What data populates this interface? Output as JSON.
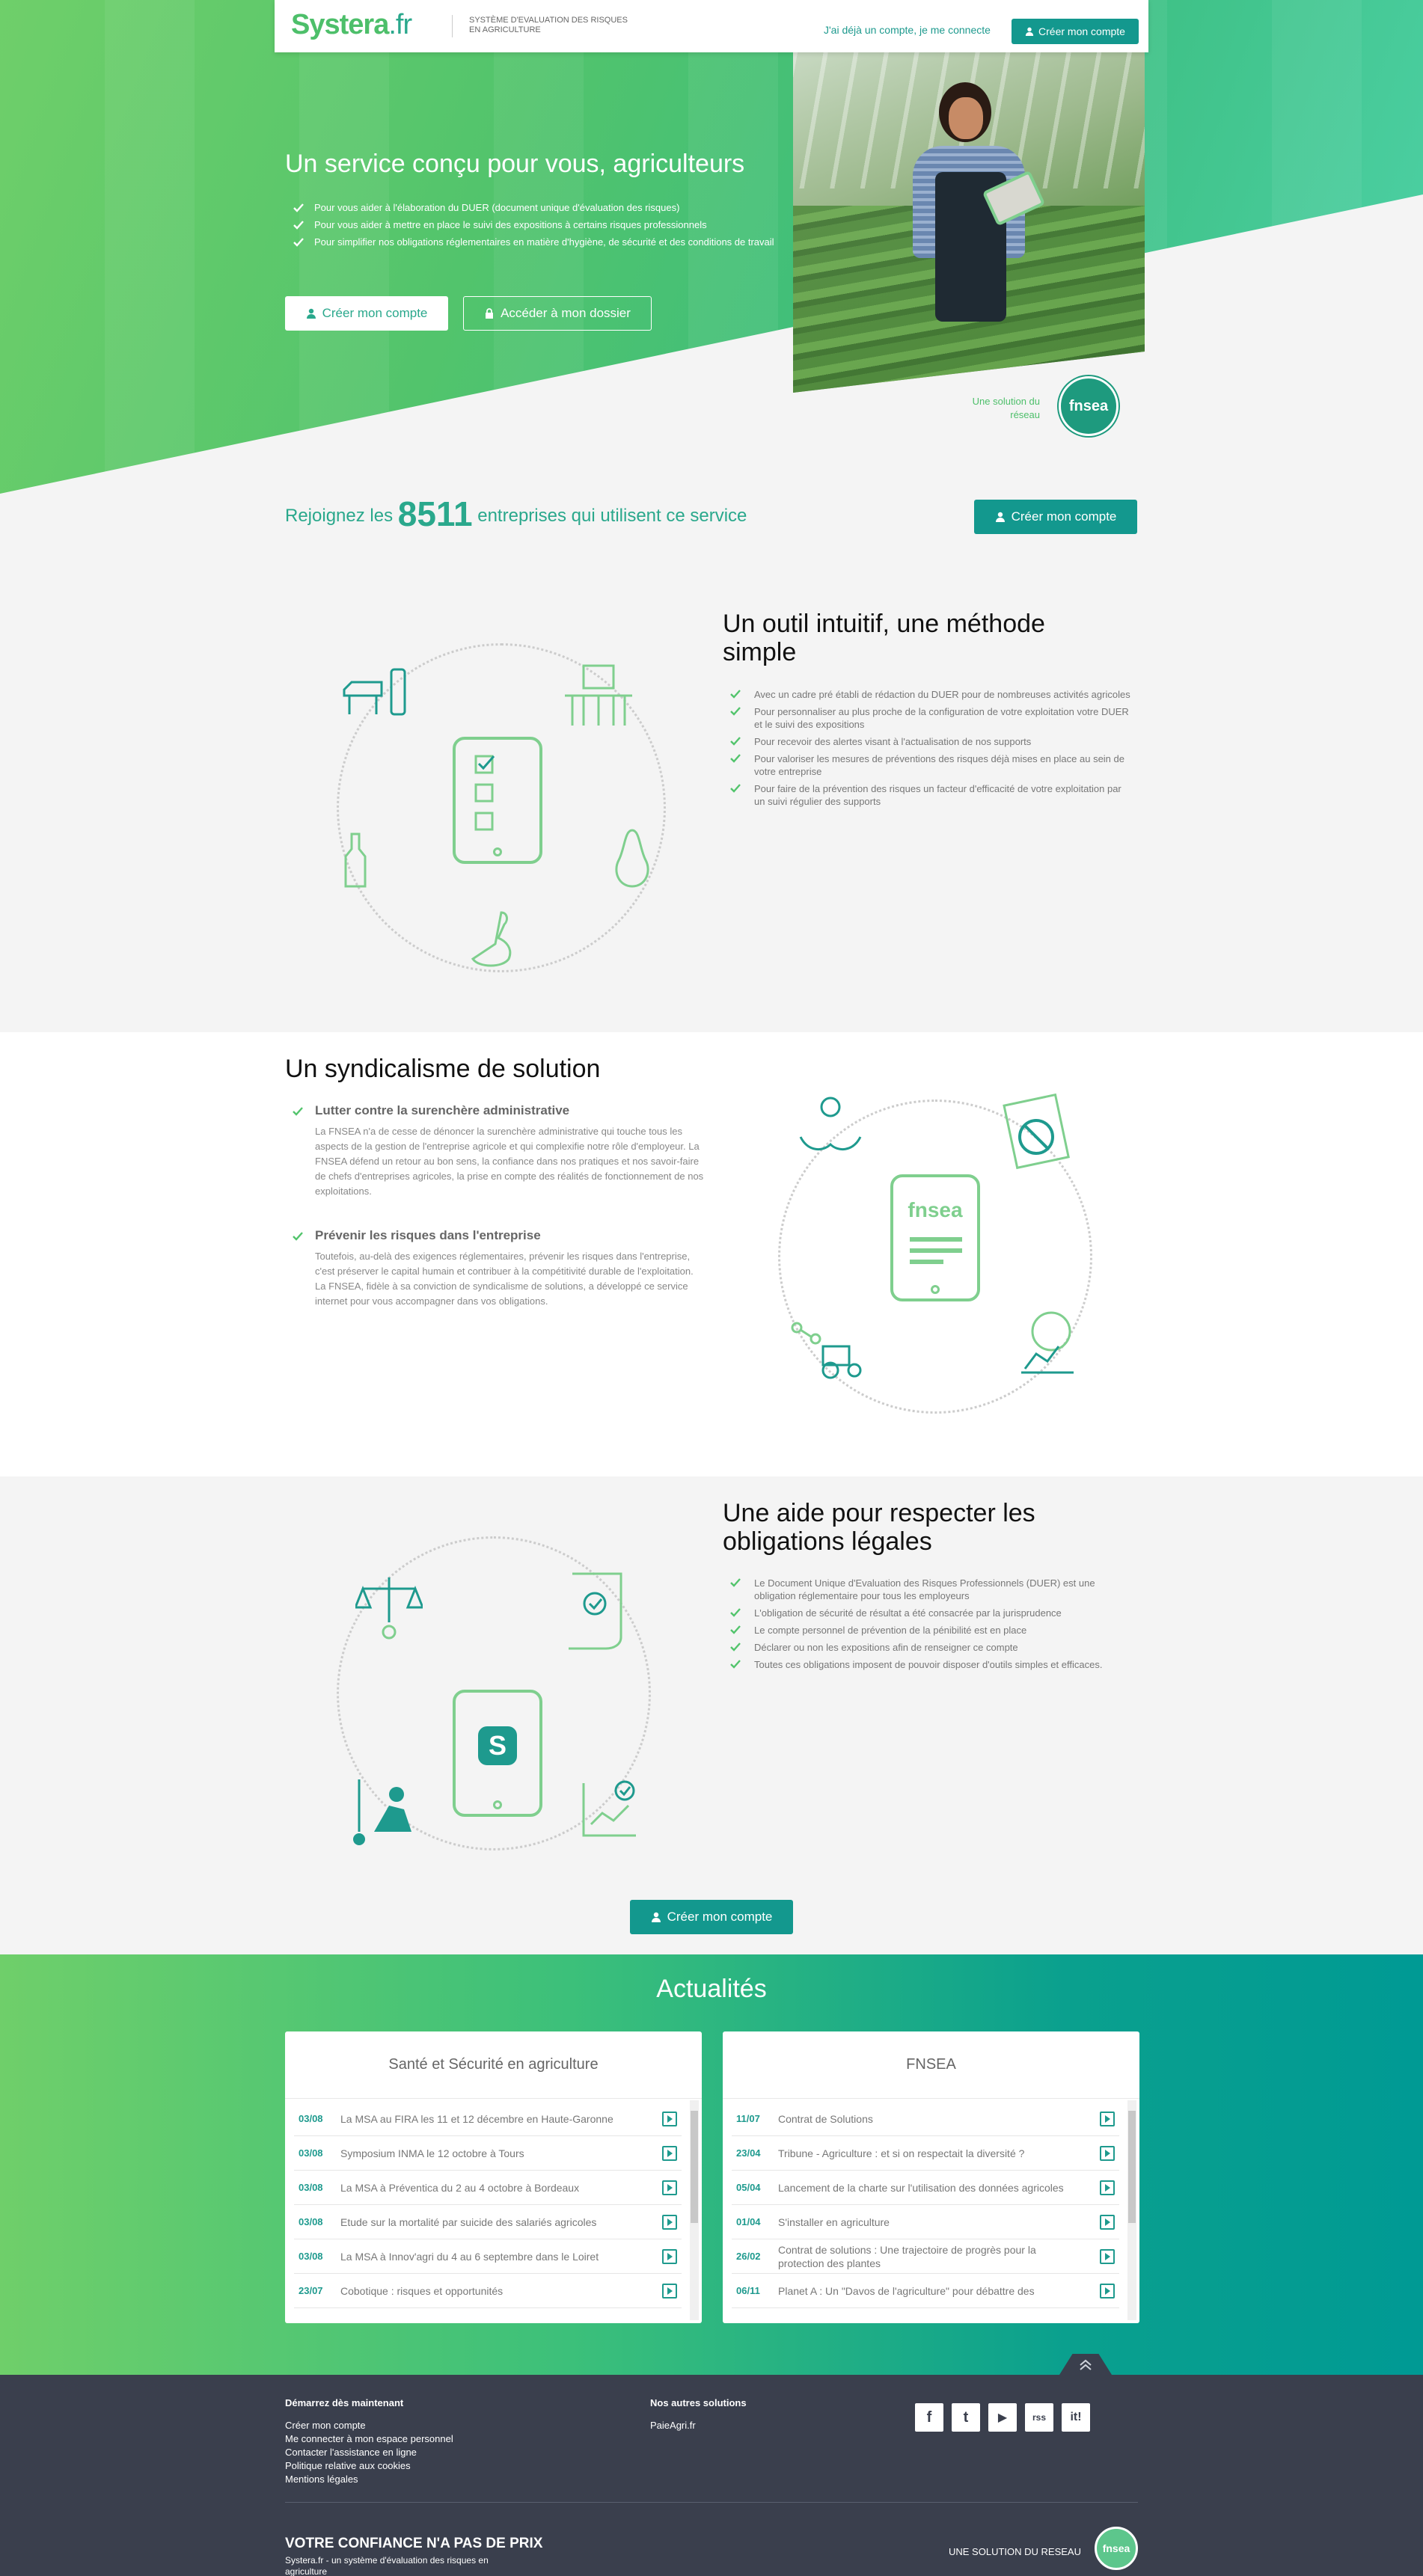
{
  "header": {
    "logo_main": "Systera",
    "logo_tld": ".fr",
    "logo_subtitle": "SYSTÈME D'EVALUATION DES RISQUES EN AGRICULTURE",
    "login_link": "J'ai déjà un compte, je me connecte",
    "create_account": "Créer mon compte"
  },
  "hero": {
    "title": "Un service conçu pour vous, agriculteurs",
    "bullets": [
      "Pour vous aider à l'élaboration du DUER (document unique d'évaluation des risques)",
      "Pour vous aider à mettre en place le suivi des expositions à certains risques professionnels",
      "Pour simplifier nos obligations réglementaires en matière d'hygiène, de sécurité et des conditions de travail"
    ],
    "btn_create": "Créer mon compte",
    "btn_access": "Accéder à mon dossier",
    "network_tag": "Une solution du réseau",
    "fnsea_badge": "fnsea"
  },
  "join": {
    "prefix": "Rejoignez les",
    "count": "8511",
    "suffix": "entreprises qui utilisent ce service",
    "button": "Créer mon compte"
  },
  "section1": {
    "title": "Un outil intuitif, une méthode simple",
    "items": [
      "Avec un cadre pré établi de rédaction du DUER pour de nombreuses activités agricoles",
      "Pour personnaliser au plus proche de la configuration de votre exploitation votre DUER et le suivi des expositions",
      "Pour recevoir des alertes visant à l'actualisation de nos supports",
      "Pour valoriser les mesures de préventions des risques déjà mises en place au sein de votre entreprise",
      "Pour faire de la prévention des risques un facteur d'efficacité de votre exploitation par un suivi régulier des supports"
    ]
  },
  "section2": {
    "title": "Un syndicalisme de solution",
    "block1_title": "Lutter contre la surenchère administrative",
    "block1_text": "La FNSEA n'a de cesse de dénoncer la surenchère administrative qui touche tous les aspects de la gestion de l'entreprise agricole et qui complexifie notre rôle d'employeur. La FNSEA défend un retour au bon sens, la confiance dans nos pratiques et nos savoir-faire de chefs d'entreprises agricoles, la prise en compte des réalités de fonctionnement de nos exploitations.",
    "block2_title": "Prévenir les risques dans l'entreprise",
    "block2_text": "Toutefois, au-delà des exigences réglementaires, prévenir les risques dans l'entreprise, c'est préserver le capital humain et contribuer à la compétitivité durable de l'exploitation. La FNSEA, fidèle à sa conviction de syndicalisme de solutions, a développé ce service internet pour vous accompagner dans vos obligations.",
    "tablet_label": "fnsea"
  },
  "section3": {
    "title": "Une aide pour respecter les obligations légales",
    "items": [
      "Le Document Unique d'Evaluation des Risques Professionnels (DUER) est une obligation réglementaire pour tous les employeurs",
      "L'obligation de sécurité de résultat a été consacrée par la jurisprudence",
      "Le compte personnel de prévention de la pénibilité est en place",
      "Déclarer ou non les expositions afin de renseigner ce compte",
      "Toutes ces obligations imposent de pouvoir disposer d'outils simples et efficaces."
    ],
    "button": "Créer mon compte"
  },
  "news": {
    "title": "Actualités",
    "left_title": "Santé et Sécurité en agriculture",
    "left_items": [
      {
        "date": "03/08",
        "text": "La MSA au FIRA les 11 et 12 décembre en Haute-Garonne"
      },
      {
        "date": "03/08",
        "text": "Symposium INMA le 12 octobre à Tours"
      },
      {
        "date": "03/08",
        "text": "La MSA à Préventica du 2 au 4 octobre à Bordeaux"
      },
      {
        "date": "03/08",
        "text": "Etude sur la mortalité par suicide des salariés agricoles"
      },
      {
        "date": "03/08",
        "text": "La MSA à Innov'agri du 4 au 6 septembre dans le Loiret"
      },
      {
        "date": "23/07",
        "text": "Cobotique : risques et opportunités"
      }
    ],
    "right_title": "FNSEA",
    "right_items": [
      {
        "date": "11/07",
        "text": "Contrat de Solutions"
      },
      {
        "date": "23/04",
        "text": "Tribune - Agriculture : et si on respectait la diversité ?"
      },
      {
        "date": "05/04",
        "text": "Lancement de la charte sur l'utilisation des données agricoles"
      },
      {
        "date": "01/04",
        "text": "S'installer en agriculture"
      },
      {
        "date": "26/02",
        "text": "Contrat de solutions : Une trajectoire de progrès pour la protection des plantes"
      },
      {
        "date": "06/11",
        "text": "Planet A : Un \"Davos de l'agriculture\" pour débattre des"
      }
    ]
  },
  "footer": {
    "col1_title": "Démarrez dès maintenant",
    "col1_links": [
      "Créer mon compte",
      "Me connecter à mon espace personnel",
      "Contacter l'assistance en ligne",
      "Politique relative aux cookies",
      "Mentions légales"
    ],
    "col2_title": "Nos autres solutions",
    "col2_links": [
      "PaieAgri.fr"
    ],
    "social": [
      "f",
      "t",
      "▶",
      "rss",
      "it!"
    ],
    "tagline": "VOTRE CONFIANCE N'A PAS DE PRIX",
    "desc": "Systera.fr - un système d'évaluation des risques en agriculture",
    "network": "UNE SOLUTION DU RESEAU",
    "badge": "fnsea"
  }
}
